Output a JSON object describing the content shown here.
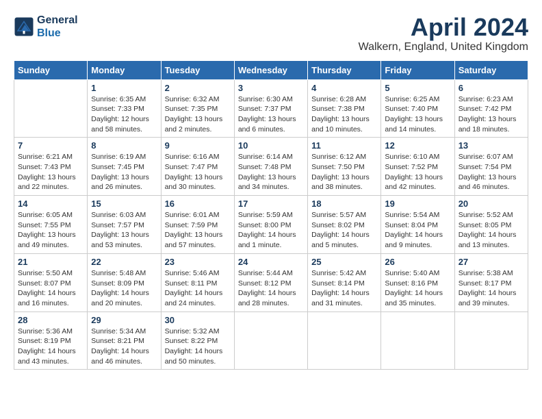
{
  "header": {
    "logo_line1": "General",
    "logo_line2": "Blue",
    "month_title": "April 2024",
    "location": "Walkern, England, United Kingdom"
  },
  "days_of_week": [
    "Sunday",
    "Monday",
    "Tuesday",
    "Wednesday",
    "Thursday",
    "Friday",
    "Saturday"
  ],
  "weeks": [
    [
      {
        "day": "",
        "info": ""
      },
      {
        "day": "1",
        "info": "Sunrise: 6:35 AM\nSunset: 7:33 PM\nDaylight: 12 hours\nand 58 minutes."
      },
      {
        "day": "2",
        "info": "Sunrise: 6:32 AM\nSunset: 7:35 PM\nDaylight: 13 hours\nand 2 minutes."
      },
      {
        "day": "3",
        "info": "Sunrise: 6:30 AM\nSunset: 7:37 PM\nDaylight: 13 hours\nand 6 minutes."
      },
      {
        "day": "4",
        "info": "Sunrise: 6:28 AM\nSunset: 7:38 PM\nDaylight: 13 hours\nand 10 minutes."
      },
      {
        "day": "5",
        "info": "Sunrise: 6:25 AM\nSunset: 7:40 PM\nDaylight: 13 hours\nand 14 minutes."
      },
      {
        "day": "6",
        "info": "Sunrise: 6:23 AM\nSunset: 7:42 PM\nDaylight: 13 hours\nand 18 minutes."
      }
    ],
    [
      {
        "day": "7",
        "info": "Sunrise: 6:21 AM\nSunset: 7:43 PM\nDaylight: 13 hours\nand 22 minutes."
      },
      {
        "day": "8",
        "info": "Sunrise: 6:19 AM\nSunset: 7:45 PM\nDaylight: 13 hours\nand 26 minutes."
      },
      {
        "day": "9",
        "info": "Sunrise: 6:16 AM\nSunset: 7:47 PM\nDaylight: 13 hours\nand 30 minutes."
      },
      {
        "day": "10",
        "info": "Sunrise: 6:14 AM\nSunset: 7:48 PM\nDaylight: 13 hours\nand 34 minutes."
      },
      {
        "day": "11",
        "info": "Sunrise: 6:12 AM\nSunset: 7:50 PM\nDaylight: 13 hours\nand 38 minutes."
      },
      {
        "day": "12",
        "info": "Sunrise: 6:10 AM\nSunset: 7:52 PM\nDaylight: 13 hours\nand 42 minutes."
      },
      {
        "day": "13",
        "info": "Sunrise: 6:07 AM\nSunset: 7:54 PM\nDaylight: 13 hours\nand 46 minutes."
      }
    ],
    [
      {
        "day": "14",
        "info": "Sunrise: 6:05 AM\nSunset: 7:55 PM\nDaylight: 13 hours\nand 49 minutes."
      },
      {
        "day": "15",
        "info": "Sunrise: 6:03 AM\nSunset: 7:57 PM\nDaylight: 13 hours\nand 53 minutes."
      },
      {
        "day": "16",
        "info": "Sunrise: 6:01 AM\nSunset: 7:59 PM\nDaylight: 13 hours\nand 57 minutes."
      },
      {
        "day": "17",
        "info": "Sunrise: 5:59 AM\nSunset: 8:00 PM\nDaylight: 14 hours\nand 1 minute."
      },
      {
        "day": "18",
        "info": "Sunrise: 5:57 AM\nSunset: 8:02 PM\nDaylight: 14 hours\nand 5 minutes."
      },
      {
        "day": "19",
        "info": "Sunrise: 5:54 AM\nSunset: 8:04 PM\nDaylight: 14 hours\nand 9 minutes."
      },
      {
        "day": "20",
        "info": "Sunrise: 5:52 AM\nSunset: 8:05 PM\nDaylight: 14 hours\nand 13 minutes."
      }
    ],
    [
      {
        "day": "21",
        "info": "Sunrise: 5:50 AM\nSunset: 8:07 PM\nDaylight: 14 hours\nand 16 minutes."
      },
      {
        "day": "22",
        "info": "Sunrise: 5:48 AM\nSunset: 8:09 PM\nDaylight: 14 hours\nand 20 minutes."
      },
      {
        "day": "23",
        "info": "Sunrise: 5:46 AM\nSunset: 8:11 PM\nDaylight: 14 hours\nand 24 minutes."
      },
      {
        "day": "24",
        "info": "Sunrise: 5:44 AM\nSunset: 8:12 PM\nDaylight: 14 hours\nand 28 minutes."
      },
      {
        "day": "25",
        "info": "Sunrise: 5:42 AM\nSunset: 8:14 PM\nDaylight: 14 hours\nand 31 minutes."
      },
      {
        "day": "26",
        "info": "Sunrise: 5:40 AM\nSunset: 8:16 PM\nDaylight: 14 hours\nand 35 minutes."
      },
      {
        "day": "27",
        "info": "Sunrise: 5:38 AM\nSunset: 8:17 PM\nDaylight: 14 hours\nand 39 minutes."
      }
    ],
    [
      {
        "day": "28",
        "info": "Sunrise: 5:36 AM\nSunset: 8:19 PM\nDaylight: 14 hours\nand 43 minutes."
      },
      {
        "day": "29",
        "info": "Sunrise: 5:34 AM\nSunset: 8:21 PM\nDaylight: 14 hours\nand 46 minutes."
      },
      {
        "day": "30",
        "info": "Sunrise: 5:32 AM\nSunset: 8:22 PM\nDaylight: 14 hours\nand 50 minutes."
      },
      {
        "day": "",
        "info": ""
      },
      {
        "day": "",
        "info": ""
      },
      {
        "day": "",
        "info": ""
      },
      {
        "day": "",
        "info": ""
      }
    ]
  ]
}
